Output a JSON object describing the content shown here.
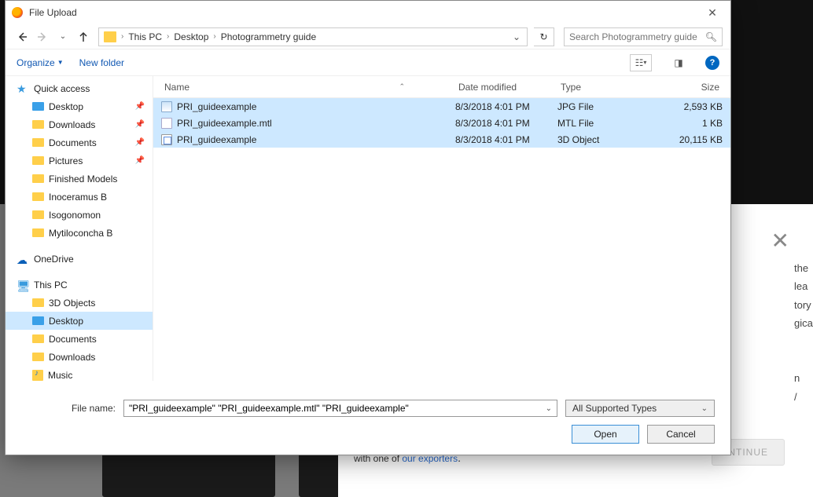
{
  "window": {
    "title": "File Upload"
  },
  "nav": {
    "breadcrumb": [
      "This PC",
      "Desktop",
      "Photogrammetry guide"
    ],
    "search_placeholder": "Search Photogrammetry guide"
  },
  "toolbar": {
    "organize": "Organize",
    "new_folder": "New folder"
  },
  "tree": {
    "quick_access": "Quick access",
    "qa_items": [
      {
        "label": "Desktop",
        "pinned": true
      },
      {
        "label": "Downloads",
        "pinned": true
      },
      {
        "label": "Documents",
        "pinned": true
      },
      {
        "label": "Pictures",
        "pinned": true
      },
      {
        "label": "Finished Models",
        "pinned": false
      },
      {
        "label": "Inoceramus B",
        "pinned": false
      },
      {
        "label": "Isogonomon",
        "pinned": false
      },
      {
        "label": "Mytiloconcha B",
        "pinned": false
      }
    ],
    "onedrive": "OneDrive",
    "this_pc": "This PC",
    "pc_items": [
      {
        "label": "3D Objects"
      },
      {
        "label": "Desktop",
        "selected": true
      },
      {
        "label": "Documents"
      },
      {
        "label": "Downloads"
      },
      {
        "label": "Music"
      }
    ]
  },
  "columns": {
    "name": "Name",
    "date": "Date modified",
    "type": "Type",
    "size": "Size"
  },
  "files": [
    {
      "name": "PRI_guideexample",
      "date": "8/3/2018 4:01 PM",
      "type": "JPG File",
      "size": "2,593 KB",
      "icon": "jpg",
      "selected": true
    },
    {
      "name": "PRI_guideexample.mtl",
      "date": "8/3/2018 4:01 PM",
      "type": "MTL File",
      "size": "1 KB",
      "icon": "mtl",
      "selected": true
    },
    {
      "name": "PRI_guideexample",
      "date": "8/3/2018 4:01 PM",
      "type": "3D Object",
      "size": "20,115 KB",
      "icon": "obj",
      "selected": true
    }
  ],
  "footer": {
    "filename_label": "File name:",
    "filename_value": "\"PRI_guideexample\" \"PRI_guideexample.mtl\" \"PRI_guideexample\"",
    "filter": "All Supported Types",
    "open": "Open",
    "cancel": "Cancel"
  },
  "background": {
    "exporters_pre": "with one of ",
    "exporters_link": "our exporters",
    "continue": "NTINUE"
  }
}
